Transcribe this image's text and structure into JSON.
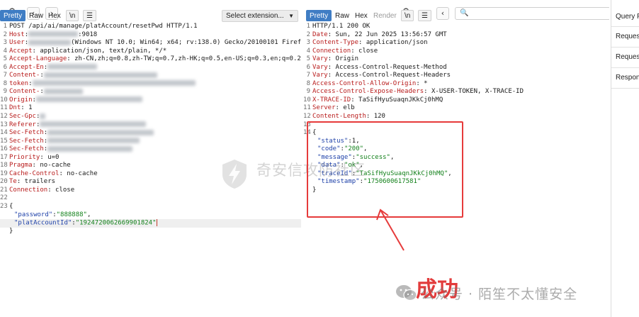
{
  "request": {
    "toolbar": {
      "pretty": "Pretty",
      "raw": "Raw",
      "hex": "Hex",
      "newline": "\\n",
      "menu": "☰",
      "extension": "Select extension..."
    },
    "lines": [
      {
        "n": "1",
        "t": "POST /api/ai/manage/platAccount/resetPwd HTTP/1.1"
      },
      {
        "n": "2",
        "k": "Host",
        "v": ":9018"
      },
      {
        "n": "3",
        "k": "User",
        "v": "(Windows NT 10.0; Win64; x64; rv:138.0) Gecko/20100101 Firefox/138.0"
      },
      {
        "n": "4",
        "k": "Accept",
        "v": " application/json, text/plain, */*"
      },
      {
        "n": "5",
        "k": "Accept-Language",
        "v": " zh-CN,zh;q=0.8,zh-TW;q=0.7,zh-HK;q=0.5,en-US;q=0.3,en;q=0.2"
      },
      {
        "n": "6",
        "k": "Accept-En",
        "v": ""
      },
      {
        "n": "7",
        "k": "Content-",
        "v": ""
      },
      {
        "n": "8",
        "k": "token",
        "v": ""
      },
      {
        "n": "9",
        "k": "Content-",
        "v": ""
      },
      {
        "n": "10",
        "k": "Origin",
        "v": ""
      },
      {
        "n": "11",
        "k": "Dnt",
        "v": " 1"
      },
      {
        "n": "12",
        "k": "Sec-Gpc",
        "v": ""
      },
      {
        "n": "13",
        "k": "Referer",
        "v": ""
      },
      {
        "n": "14",
        "k": "Sec-Fetch",
        "v": ""
      },
      {
        "n": "15",
        "k": "Sec-Fetch",
        "v": ""
      },
      {
        "n": "16",
        "k": "Sec-Fetch",
        "v": ""
      },
      {
        "n": "17",
        "k": "Priority",
        "v": " u=0"
      },
      {
        "n": "18",
        "k": "Pragma",
        "v": " no-cache"
      },
      {
        "n": "19",
        "k": "Cache-Control",
        "v": " no-cache"
      },
      {
        "n": "20",
        "k": "Te",
        "v": " trailers"
      },
      {
        "n": "21",
        "k": "Connection",
        "v": " close"
      },
      {
        "n": "22",
        "t": ""
      },
      {
        "n": "23",
        "t": "{"
      },
      {
        "n": "",
        "jk": "\"password\"",
        "jv": "\"888888\"",
        "end": ","
      },
      {
        "n": "",
        "jk": "\"platAccountId\"",
        "jv": "\"1924720062669901824\"",
        "end": ""
      },
      {
        "n": "",
        "t": "}"
      }
    ]
  },
  "response": {
    "toolbar": {
      "pretty": "Pretty",
      "raw": "Raw",
      "hex": "Hex",
      "render": "Render",
      "newline": "\\n",
      "menu": "☰"
    },
    "lines": [
      {
        "n": "1",
        "t": "HTTP/1.1 200 OK"
      },
      {
        "n": "2",
        "k": "Date",
        "v": " Sun, 22 Jun 2025 13:56:57 GMT"
      },
      {
        "n": "3",
        "k": "Content-Type",
        "v": " application/json"
      },
      {
        "n": "4",
        "k": "Connection",
        "v": " close"
      },
      {
        "n": "5",
        "k": "Vary",
        "v": " Origin"
      },
      {
        "n": "6",
        "k": "Vary",
        "v": " Access-Control-Request-Method"
      },
      {
        "n": "7",
        "k": "Vary",
        "v": " Access-Control-Request-Headers"
      },
      {
        "n": "8",
        "k": "Access-Control-Allow-Origin",
        "v": " *"
      },
      {
        "n": "9",
        "k": "Access-Control-Expose-Headers",
        "v": " X-USER-TOKEN, X-TRACE-ID"
      },
      {
        "n": "10",
        "k": "X-TRACE-ID",
        "v": " TaSifHyuSuaqnJKkCj0hMQ"
      },
      {
        "n": "11",
        "k": "Server",
        "v": " elb"
      },
      {
        "n": "12",
        "k": "Content-Length",
        "v": " 120"
      },
      {
        "n": "13",
        "t": ""
      },
      {
        "n": "14",
        "t": "{"
      },
      {
        "n": "",
        "jk": "\"status\"",
        "jv": "1",
        "end": ",",
        "num": true
      },
      {
        "n": "",
        "jk": "\"code\"",
        "jv": "\"200\"",
        "end": ","
      },
      {
        "n": "",
        "jk": "\"message\"",
        "jv": "\"success\"",
        "end": ","
      },
      {
        "n": "",
        "jk": "\"data\"",
        "jv": "\"ok\"",
        "end": ","
      },
      {
        "n": "",
        "jk": "\"traceId\"",
        "jv": "\"TaSifHyuSuaqnJKkCj0hMQ\"",
        "end": ","
      },
      {
        "n": "",
        "jk": "\"timestamp\"",
        "jv": "\"1750600617581\"",
        "end": ""
      },
      {
        "n": "",
        "t": "}"
      }
    ]
  },
  "inspector": {
    "items": [
      "Query P",
      "Request",
      "Request",
      "Respons"
    ]
  },
  "annotation": {
    "label": "成功"
  },
  "watermark": {
    "center": "奇安信攻防社区",
    "bottom": "公众号 · 陌笙不太懂安全"
  },
  "colors": {
    "header_key": "#b81b1b",
    "json_key": "#1c3fa8",
    "json_string": "#12801a",
    "callout": "#e63b3b",
    "pretty_active": "#3f7dc4"
  }
}
